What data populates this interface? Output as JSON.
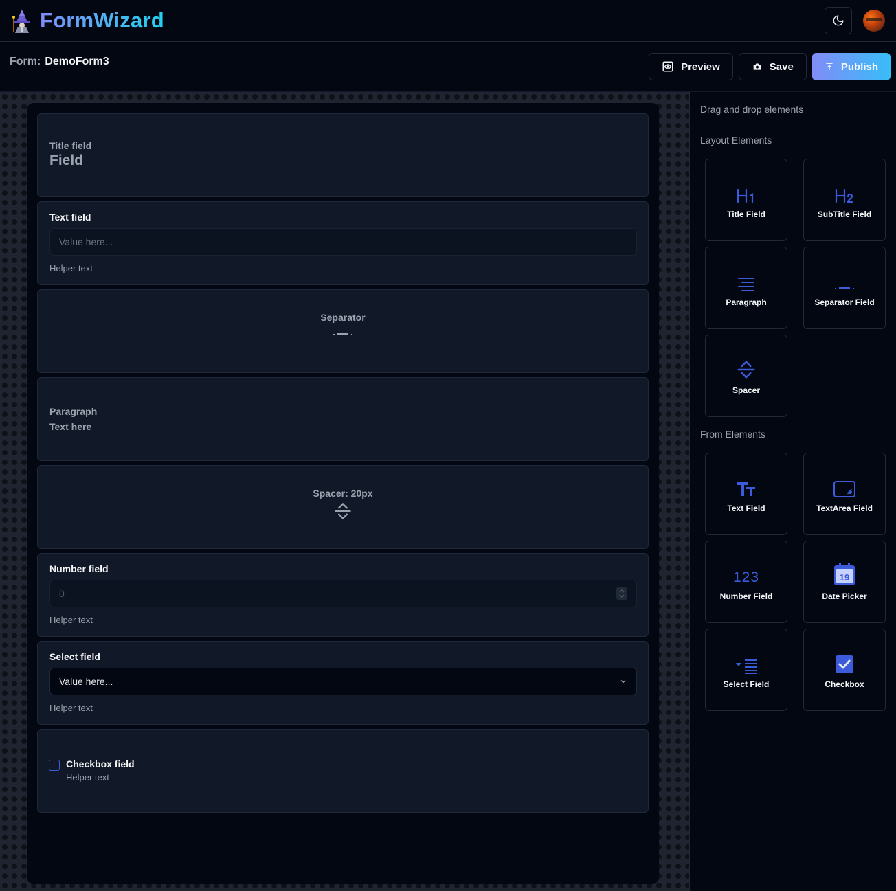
{
  "app": {
    "title": "FormWizard"
  },
  "header": {
    "form_label": "Form:",
    "form_name": "DemoForm3"
  },
  "toolbar": {
    "preview_label": "Preview",
    "save_label": "Save",
    "publish_label": "Publish"
  },
  "canvas": {
    "title_card": {
      "label": "Title field",
      "value": "Field"
    },
    "text_card": {
      "label": "Text field",
      "placeholder": "Value here...",
      "helper": "Helper text"
    },
    "separator_card": {
      "label": "Separator"
    },
    "paragraph_card": {
      "label": "Paragraph",
      "value": "Text here"
    },
    "spacer_card": {
      "label": "Spacer: 20px"
    },
    "number_card": {
      "label": "Number field",
      "placeholder": "0",
      "helper": "Helper text"
    },
    "select_card": {
      "label": "Select field",
      "value": "Value here...",
      "helper": "Helper text"
    },
    "checkbox_card": {
      "label": "Checkbox field",
      "helper": "Helper text"
    }
  },
  "panel": {
    "title": "Drag and drop elements",
    "layout_title": "Layout Elements",
    "layout_items": [
      "Title Field",
      "SubTitle Field",
      "Paragraph",
      "Separator Field",
      "Spacer"
    ],
    "form_title": "From Elements",
    "form_items": [
      "Text Field",
      "TextArea Field",
      "Number Field",
      "Date Picker",
      "Select Field",
      "Checkbox"
    ],
    "date_icon_day": "19",
    "number_icon_text": "123"
  },
  "colors": {
    "accent": "#3b5bdb",
    "brand_from": "#818cf8",
    "brand_to": "#22d3ee"
  }
}
